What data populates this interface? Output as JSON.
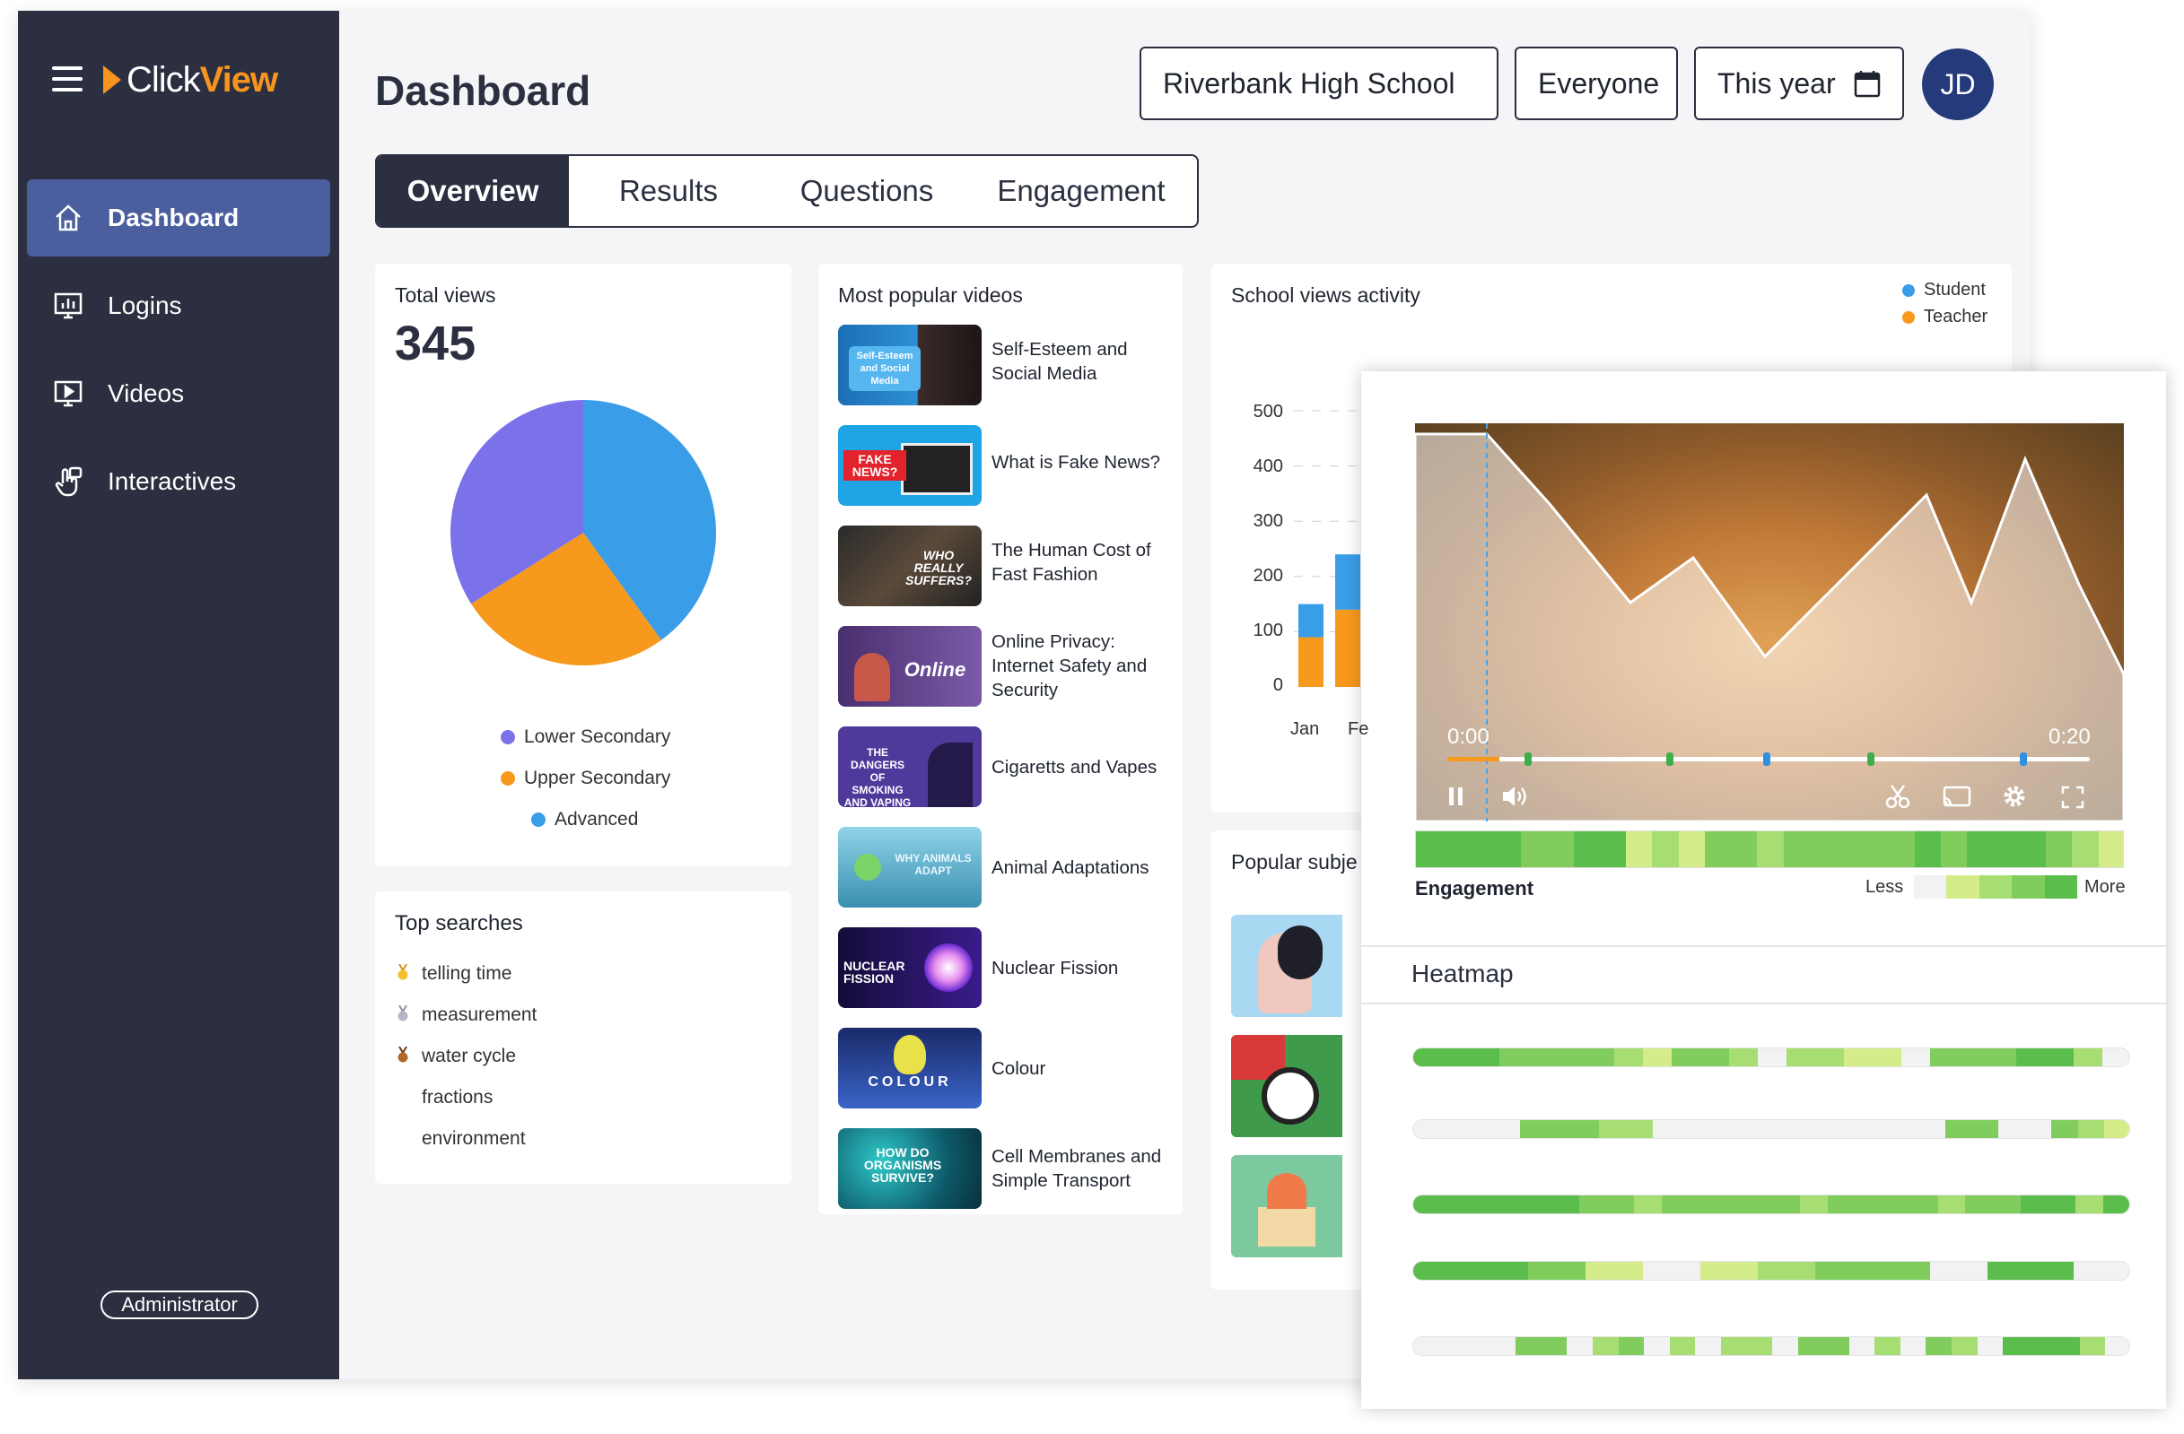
{
  "app": {
    "logo_text_1": "Click",
    "logo_text_2": "View"
  },
  "sidebar": {
    "items": [
      {
        "label": "Dashboard",
        "icon": "home-icon",
        "active": true
      },
      {
        "label": "Logins",
        "icon": "chart-screen-icon"
      },
      {
        "label": "Videos",
        "icon": "video-play-icon"
      },
      {
        "label": "Interactives",
        "icon": "touch-hand-icon"
      }
    ],
    "role": "Administrator"
  },
  "header": {
    "title": "Dashboard",
    "school": "Riverbank High School",
    "audience": "Everyone",
    "period": "This year",
    "avatar_initials": "JD"
  },
  "tabs": [
    "Overview",
    "Results",
    "Questions",
    "Engagement"
  ],
  "total_views": {
    "title": "Total views",
    "value": "345",
    "legend": [
      {
        "label": "Lower Secondary",
        "color": "#7b72e9"
      },
      {
        "label": "Upper Secondary",
        "color": "#f7991d"
      },
      {
        "label": "Advanced",
        "color": "#3a9de8"
      }
    ]
  },
  "top_searches": {
    "title": "Top searches",
    "items": [
      "telling time",
      "measurement",
      "water cycle",
      "fractions",
      "environment"
    ]
  },
  "popular_videos": {
    "title": "Most popular videos",
    "items": [
      {
        "title": "Self-Esteem and Social Media",
        "thumb_text": "Self-Esteem and Social Media"
      },
      {
        "title": "What is Fake News?",
        "thumb_text": "FAKE NEWS?"
      },
      {
        "title": "The Human Cost of Fast Fashion",
        "thumb_text": "WHO REALLY SUFFERS?"
      },
      {
        "title": "Online Privacy: Internet Safety and Security",
        "thumb_text": "Online"
      },
      {
        "title": "Cigaretts and Vapes",
        "thumb_text": "THE DANGERS OF SMOKING AND VAPING"
      },
      {
        "title": "Animal Adaptations",
        "thumb_text": "WHY ANIMALS ADAPT"
      },
      {
        "title": "Nuclear Fission",
        "thumb_text": "NUCLEAR FISSION"
      },
      {
        "title": "Colour",
        "thumb_text": "COLOUR"
      },
      {
        "title": "Cell Membranes and Simple Transport",
        "thumb_text": "HOW DO ORGANISMS SURVIVE?"
      }
    ]
  },
  "school_views": {
    "title": "School views activity",
    "legend": [
      {
        "label": "Student",
        "color": "#3a9de8"
      },
      {
        "label": "Teacher",
        "color": "#f7991d"
      }
    ],
    "y_ticks": [
      "500",
      "400",
      "300",
      "200",
      "100",
      "0"
    ],
    "x_ticks": [
      "Jan",
      "Fe"
    ]
  },
  "popular_subjects": {
    "title": "Popular subje"
  },
  "player": {
    "time_start": "0:00",
    "time_end": "0:20",
    "engagement_label": "Engagement",
    "less_label": "Less",
    "more_label": "More"
  },
  "heatmap": {
    "title": "Heatmap"
  },
  "chart_data": [
    {
      "type": "pie",
      "title": "Total views",
      "categories": [
        "Lower Secondary",
        "Upper Secondary",
        "Advanced"
      ],
      "values": [
        34,
        26,
        40
      ],
      "colors": [
        "#7b72e9",
        "#f7991d",
        "#3a9de8"
      ]
    },
    {
      "type": "bar",
      "title": "School views activity",
      "categories": [
        "Jan",
        "Fe"
      ],
      "series": [
        {
          "name": "Teacher",
          "values": [
            90,
            140
          ]
        },
        {
          "name": "Student",
          "values": [
            60,
            100
          ]
        }
      ],
      "ylim": [
        0,
        500
      ]
    }
  ]
}
